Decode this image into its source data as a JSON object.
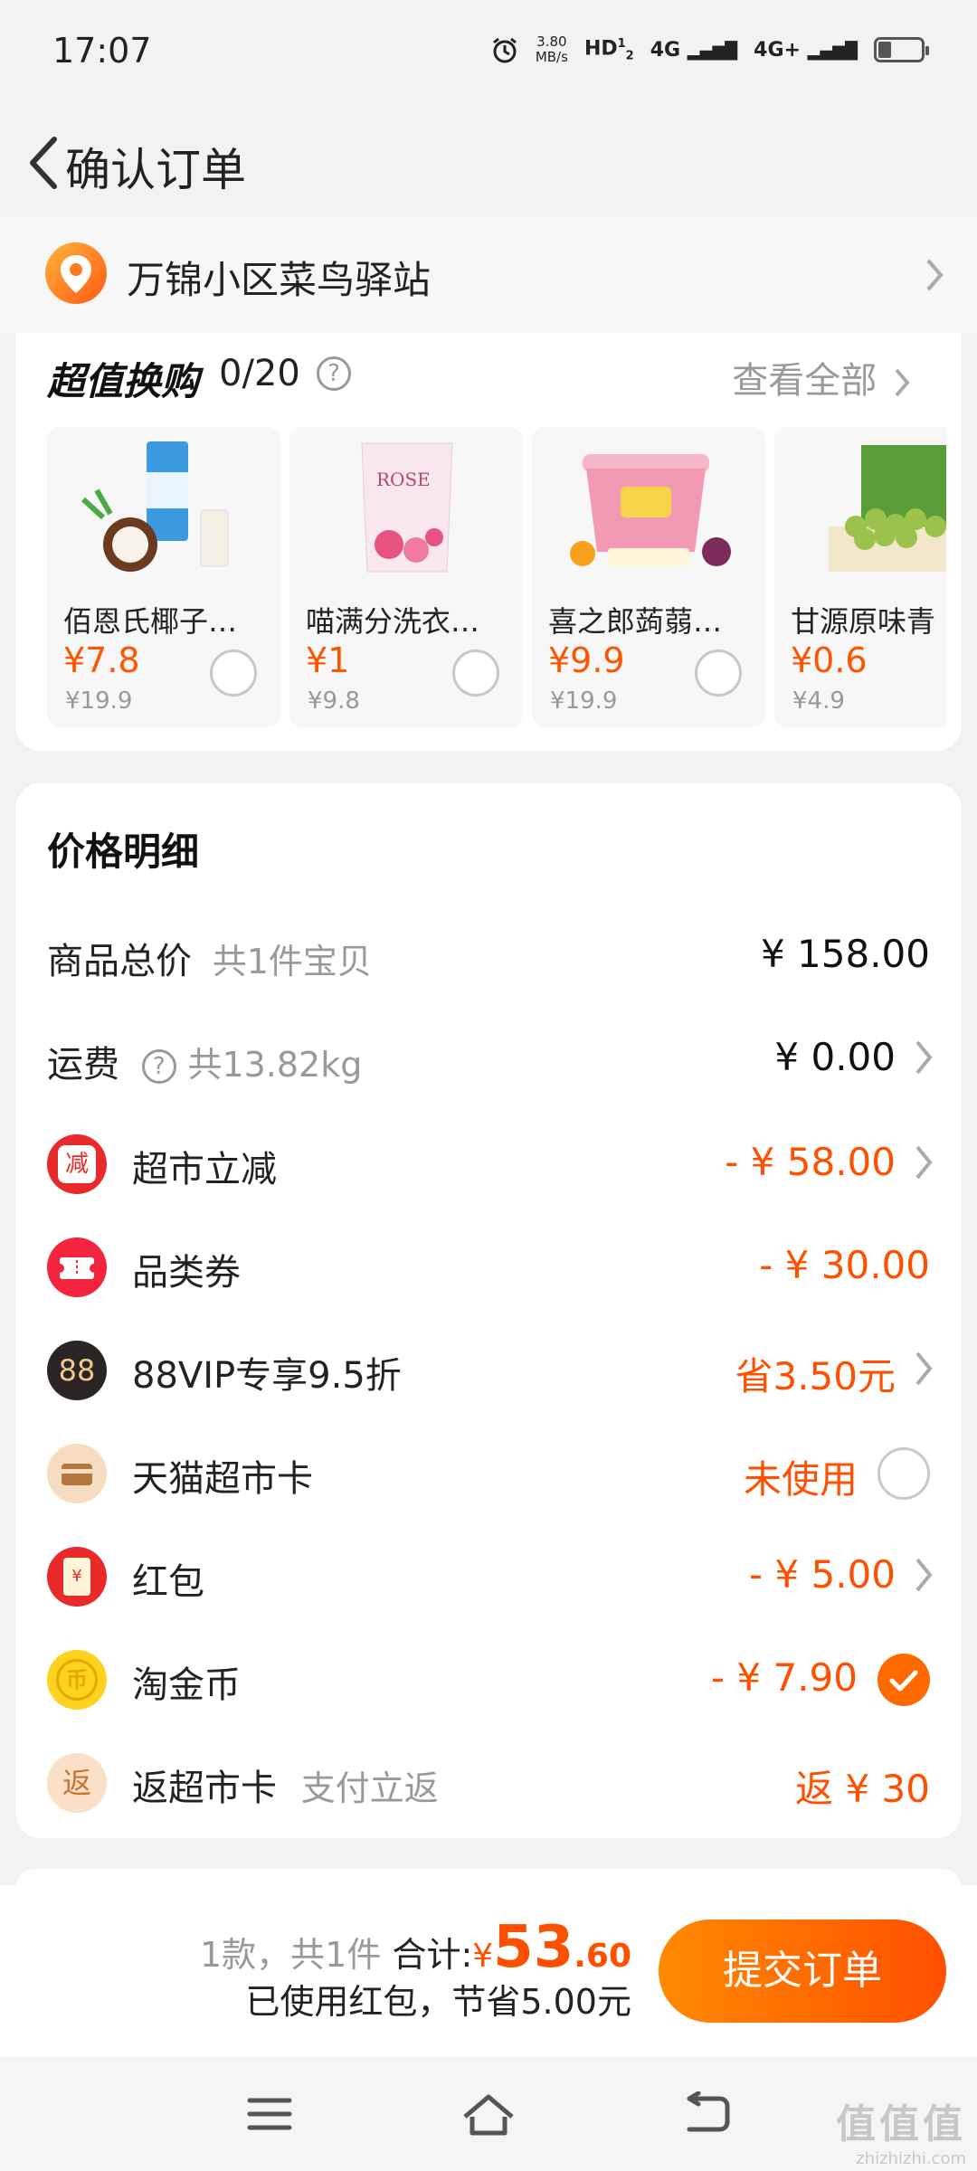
{
  "status": {
    "time": "17:07",
    "speed_value": "3.80",
    "speed_unit": "MB/s",
    "hd": "HD",
    "sim1": "1",
    "sim2": "2",
    "net1": "4G",
    "net2": "4G+"
  },
  "header": {
    "title": "确认订单"
  },
  "address": {
    "text": "万锦小区菜鸟驿站"
  },
  "swap": {
    "title": "超值换购",
    "count": "0/20",
    "help": "?",
    "view_all": "查看全部",
    "products": [
      {
        "name": "佰恩氏椰子…",
        "price": "¥7.8",
        "original": "¥19.9"
      },
      {
        "name": "喵满分洗衣…",
        "price": "¥1",
        "original": "¥9.8"
      },
      {
        "name": "喜之郎蒟蒻…",
        "price": "¥9.9",
        "original": "¥19.9"
      },
      {
        "name": "甘源原味青",
        "price": "¥0.6",
        "original": "¥4.9"
      }
    ],
    "product_image_texts": [
      "ROSE"
    ]
  },
  "price_detail": {
    "title": "价格明细",
    "rows": [
      {
        "label": "商品总价",
        "sub": "共1件宝贝",
        "value": "¥ 158.00"
      },
      {
        "label": "运费",
        "help": "?",
        "sub": "共13.82kg",
        "value": "¥ 0.00"
      },
      {
        "icon_text": "减",
        "label": "超市立减",
        "value": "- ¥ 58.00"
      },
      {
        "label": "品类券",
        "value": "- ¥ 30.00"
      },
      {
        "icon_text": "88",
        "label": "88VIP专享9.5折",
        "value": "省3.50元"
      },
      {
        "label": "天猫超市卡",
        "value": "未使用"
      },
      {
        "icon_text": "¥",
        "label": "红包",
        "value": "- ¥ 5.00"
      },
      {
        "icon_text": "币",
        "label": "淘金币",
        "value": "- ¥ 7.90"
      },
      {
        "icon_text": "返",
        "label": "返超市卡",
        "sub": "支付立返",
        "value": "返 ¥ 30"
      }
    ]
  },
  "checkout": {
    "count_text": "1款，共1件",
    "total_label": "合计:",
    "currency": "¥",
    "total_int": "53",
    "total_dec": ".60",
    "savings": "已使用红包，节省5.00元",
    "submit": "提交订单"
  },
  "watermark": {
    "big": "值值值",
    "small": "zhizhizhi.com"
  },
  "colors": {
    "accent": "#ff5000",
    "button_start": "#ff8a00",
    "button_end": "#ff4f00",
    "muted": "#999999"
  }
}
